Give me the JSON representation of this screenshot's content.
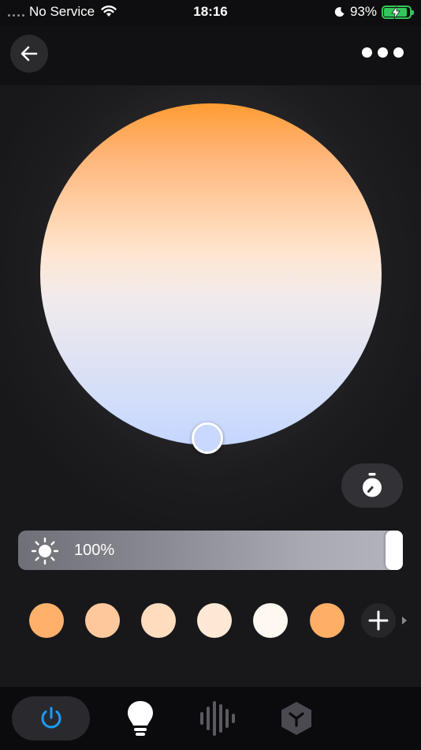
{
  "status_bar": {
    "carrier": "No Service",
    "time": "18:16",
    "battery_percent": "93%",
    "battery_level": 0.93,
    "icons": [
      "signal-dots",
      "wifi-icon",
      "moon-icon",
      "battery-icon"
    ]
  },
  "header": {
    "back_icon": "arrow-left-icon",
    "more_icon": "ellipsis-icon"
  },
  "color_wheel": {
    "gradient_colors": [
      "#ff9c33",
      "#ffcfa6",
      "#f2ebeb",
      "#c4d6ff"
    ],
    "selected_color": "#c8d8ff"
  },
  "timer": {
    "icon": "timer-icon"
  },
  "brightness": {
    "value_label": "100%",
    "level": 1.0,
    "icon": "sun-icon"
  },
  "presets": [
    {
      "color": "#ffb06a"
    },
    {
      "color": "#ffc89c"
    },
    {
      "color": "#ffdcbe"
    },
    {
      "color": "#ffe8d6"
    },
    {
      "color": "#fff8f0"
    },
    {
      "color": "#ffae66"
    }
  ],
  "add_preset": {
    "icon": "plus-icon"
  },
  "bottom_nav": {
    "items": [
      {
        "icon": "power-icon",
        "active": true,
        "color": "#1a9cff"
      },
      {
        "icon": "lightbulb-icon",
        "active": false
      },
      {
        "icon": "music-waveform-icon",
        "active": false
      },
      {
        "icon": "scene-cube-icon",
        "active": false
      }
    ]
  }
}
